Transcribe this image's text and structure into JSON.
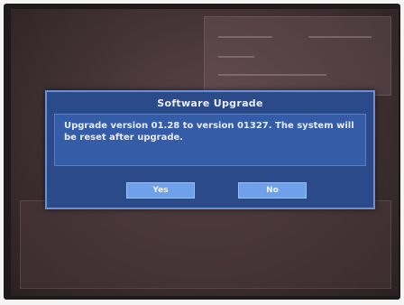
{
  "dialog": {
    "title": "Software Upgrade",
    "message": "Upgrade version 01.28 to version 01327. The system will be reset after upgrade.",
    "yes_label": "Yes",
    "no_label": "No"
  },
  "colors": {
    "dialog_bg": "#2a4a8a",
    "dialog_body": "#355ca6",
    "button": "#6fa0ea"
  }
}
